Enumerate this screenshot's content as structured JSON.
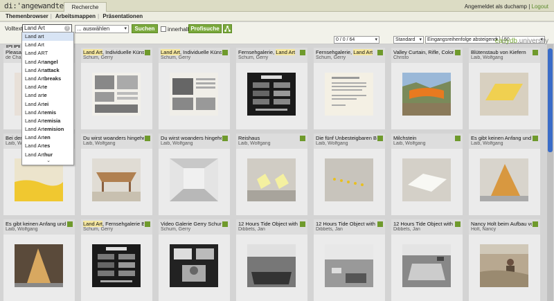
{
  "app": {
    "logo": "di:'angewandte",
    "active_tab": "Recherche"
  },
  "login": {
    "prefix": "Angemeldet als duchamp",
    "separator": "|",
    "logout": "Logout"
  },
  "nav": {
    "items": [
      "Themenbrowser",
      "Arbeitsmappen",
      "Präsentationen"
    ]
  },
  "search": {
    "label": "Volltext",
    "value": "Land Art",
    "scope_select": "... auswählen",
    "search_button": "Suchen",
    "within_label": "innerhalb",
    "profile_button": "Profisuche"
  },
  "brand": {
    "part1": "easydb",
    "part2": ".university"
  },
  "results": {
    "count": "0 / 0 / 64",
    "view": "Standard",
    "sort": "Eingangsreihenfolge absteigend",
    "per_page": "50"
  },
  "autocomplete": {
    "items": [
      "Land art",
      "Land Art",
      "Land ART",
      "Land Artangel",
      "Land Artattack",
      "Land Artbreaks",
      "Land Arte",
      "Land arte",
      "Land Artei",
      "Land Artemis",
      "Land Artemisia",
      "Land Artemision",
      "Land Arten",
      "Land Artes",
      "Land Arthur"
    ],
    "bold_suffix": [
      "",
      "",
      "",
      "angel",
      "attack",
      "breaks",
      "e",
      "e",
      "ei",
      "emis",
      "emisia",
      "emision",
      "en",
      "es",
      "hur"
    ],
    "more_icon": "chevron-down"
  },
  "cards": [
    {
      "title_pre": "Pleasant Land",
      "hl": "",
      "title_post": "",
      "author": "de Chardin",
      "thumb": "figure"
    },
    {
      "title_pre": "",
      "hl": "Land Art",
      "title_post": ", Individuelle Künstler",
      "author": "Schum, Gerry",
      "thumb": "doc"
    },
    {
      "title_pre": "",
      "hl": "Land Art",
      "title_post": ", Individuelle Künstler",
      "author": "Schum, Gerry",
      "thumb": "doc2"
    },
    {
      "title_pre": "Fernsehgalerie, ",
      "hl": "Land Art",
      "title_post": "",
      "author": "Schum, Gerry",
      "thumb": "poster"
    },
    {
      "title_pre": "Fernsehgalerie, ",
      "hl": "Land Art",
      "title_post": "",
      "author": "Schum, Gerry",
      "thumb": "letter"
    },
    {
      "title_pre": "Valley Curtain, Rifle, Colorado",
      "hl": "",
      "title_post": "",
      "author": "Christo",
      "thumb": "valley"
    },
    {
      "title_pre": "Blütenstaub von Kiefern",
      "hl": "",
      "title_post": "",
      "author": "Laib, Wolfgang",
      "thumb": "pollen"
    },
    {
      "title_pre": "Bei der Arbeit",
      "hl": "",
      "title_post": "",
      "author": "Laib, Wolfgang",
      "thumb": "yellowfield"
    },
    {
      "title_pre": "Du wirst woanders hingehen",
      "hl": "",
      "title_post": "",
      "author": "Laib, Wolfgang",
      "thumb": "boat"
    },
    {
      "title_pre": "Du wirst woanders hingehen",
      "hl": "",
      "title_post": "",
      "author": "Laib, Wolfgang",
      "thumb": "room"
    },
    {
      "title_pre": "Reishaus",
      "hl": "",
      "title_post": "",
      "author": "Laib, Wolfgang",
      "thumb": "reishaus"
    },
    {
      "title_pre": "Die fünf Unbesteigbaren Berge",
      "hl": "",
      "title_post": "",
      "author": "Laib, Wolfgang",
      "thumb": "dots"
    },
    {
      "title_pre": "Milchstein",
      "hl": "",
      "title_post": "",
      "author": "Laib, Wolfgang",
      "thumb": "milk"
    },
    {
      "title_pre": "Es gibt keinen Anfang und",
      "hl": "",
      "title_post": "",
      "author": "Laib, Wolfgang",
      "thumb": "pyramid"
    },
    {
      "title_pre": "Es gibt keinen Anfang und",
      "hl": "",
      "title_post": "",
      "author": "Laib, Wolfgang",
      "thumb": "pyramid2"
    },
    {
      "title_pre": "",
      "hl": "Land Art",
      "title_post": ", Fernsehgalerie Berlin",
      "author": "Schum, Gerry",
      "thumb": "poster"
    },
    {
      "title_pre": "Video Galerie Gerry Schum",
      "hl": "",
      "title_post": "",
      "author": "Schum, Gerry",
      "thumb": "video"
    },
    {
      "title_pre": "12 Hours Tide Object with",
      "hl": "",
      "title_post": "",
      "author": "Dibbets, Jan",
      "thumb": "tide1"
    },
    {
      "title_pre": "12 Hours Tide Object with",
      "hl": "",
      "title_post": "",
      "author": "Dibbets, Jan",
      "thumb": "tide2"
    },
    {
      "title_pre": "12 Hours Tide Object with",
      "hl": "",
      "title_post": "",
      "author": "Dibbets, Jan",
      "thumb": "tide3"
    },
    {
      "title_pre": "Nancy Holt beim Aufbau von",
      "hl": "",
      "title_post": "",
      "author": "Holt, Nancy",
      "thumb": "nancy"
    }
  ],
  "colors": {
    "accent": "#7aa83c",
    "highlight": "#f5e7a0",
    "scroll": "#3a6cc8"
  }
}
